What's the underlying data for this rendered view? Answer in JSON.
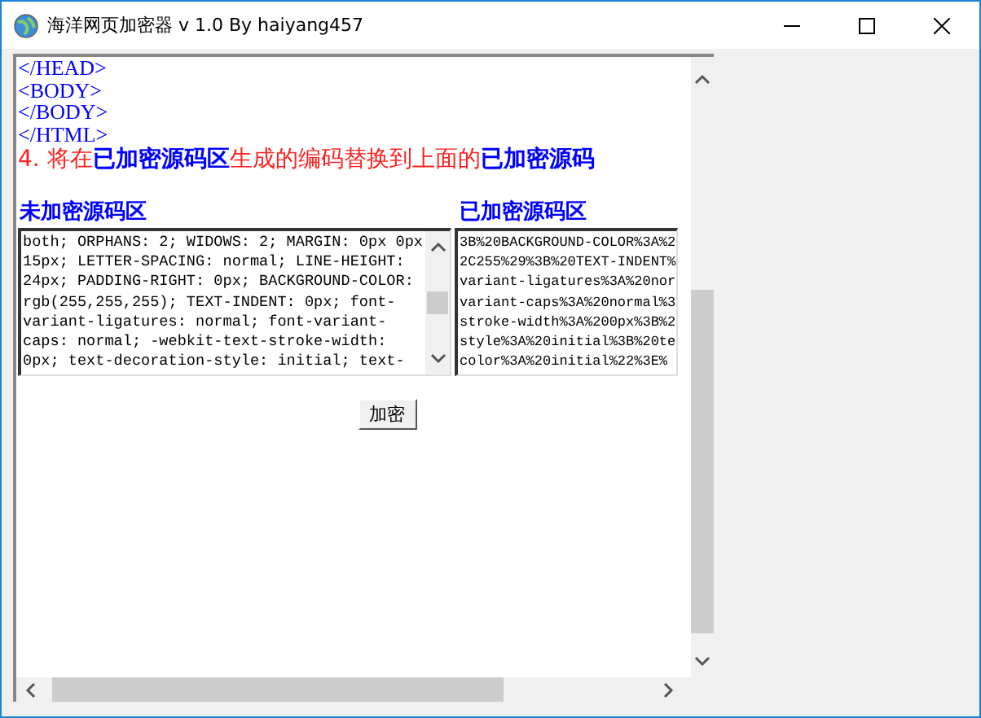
{
  "window": {
    "title": "海洋网页加密器 v 1.0  By haiyang457"
  },
  "html_lines": [
    "</HEAD>",
    "<BODY>",
    "</BODY>",
    "</HTML>"
  ],
  "step": [
    {
      "kind": "plain",
      "text": "4. 将在"
    },
    {
      "kind": "highlight",
      "text": "已加密源码区"
    },
    {
      "kind": "plain",
      "text": "生成的编码替换到上面的"
    },
    {
      "kind": "highlight",
      "text": "已加密源码"
    }
  ],
  "panes": [
    {
      "heading": "未加密源码区",
      "lines": [
        "both; ORPHANS: 2; WIDOWS: 2; MARGIN: 0px 0px",
        "15px; LETTER-SPACING: normal; LINE-HEIGHT:",
        "24px; PADDING-RIGHT: 0px; BACKGROUND-COLOR:",
        "rgb(255,255,255); TEXT-INDENT: 0px; font-",
        "variant-ligatures: normal; font-variant-",
        "caps: normal; -webkit-text-stroke-width:",
        "0px; text-decoration-style: initial; text-"
      ]
    },
    {
      "heading": "已加密源码区",
      "lines": [
        "3B%20BACKGROUND-COLOR%3A%2",
        "2C255%29%3B%20TEXT-INDENT%",
        "variant-ligatures%3A%20nor",
        "variant-caps%3A%20normal%3",
        "stroke-width%3A%200px%3B%2",
        "style%3A%20initial%3B%20te",
        "color%3A%20initial%22%3E%"
      ]
    }
  ],
  "encrypt_button": "加密"
}
